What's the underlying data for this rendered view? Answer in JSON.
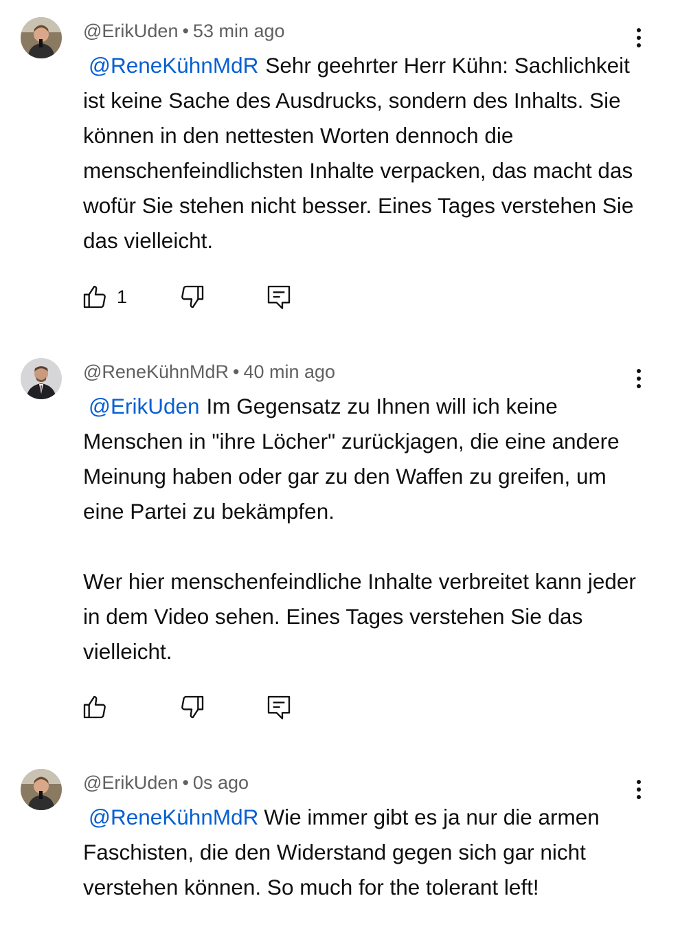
{
  "comments": [
    {
      "author": "@ErikUden",
      "time": "53 min ago",
      "mention": "@ReneKühnMdR",
      "text_first": "Sehr geehrter Herr Kühn: Sachlichkeit ist keine Sache des Ausdrucks, sondern des Inhalts. Sie können in den nettesten Worten dennoch die menschenfeindlichsten Inhalte verpacken, das macht das wofür Sie stehen nicht besser. Eines Tages verstehen Sie das vielleicht.",
      "text_second": "",
      "like_count": "1",
      "avatar_icon": "person-with-microphone-avatar"
    },
    {
      "author": "@ReneKühnMdR",
      "time": "40 min ago",
      "mention": "@ErikUden",
      "text_first": "Im Gegensatz zu Ihnen will ich keine Menschen in \"ihre Löcher\" zurückjagen, die eine andere Meinung haben oder gar zu den Waffen zu greifen, um eine Partei zu bekämpfen.",
      "text_second": "Wer hier menschenfeindliche Inhalte verbreitet kann jeder in dem Video sehen. Eines Tages verstehen Sie das vielleicht.",
      "like_count": "",
      "avatar_icon": "man-in-suit-avatar"
    },
    {
      "author": "@ErikUden",
      "time": "0s ago",
      "mention": "@ReneKühnMdR",
      "text_first": "Wie immer gibt es ja nur die armen Faschisten, die den Widerstand gegen sich gar nicht verstehen können. So much for the tolerant left!",
      "text_second": "",
      "like_count": "",
      "avatar_icon": "person-with-microphone-avatar"
    }
  ],
  "separator": "•",
  "colors": {
    "mention": "#065fd4",
    "meta": "#606060",
    "text": "#0f0f0f"
  }
}
